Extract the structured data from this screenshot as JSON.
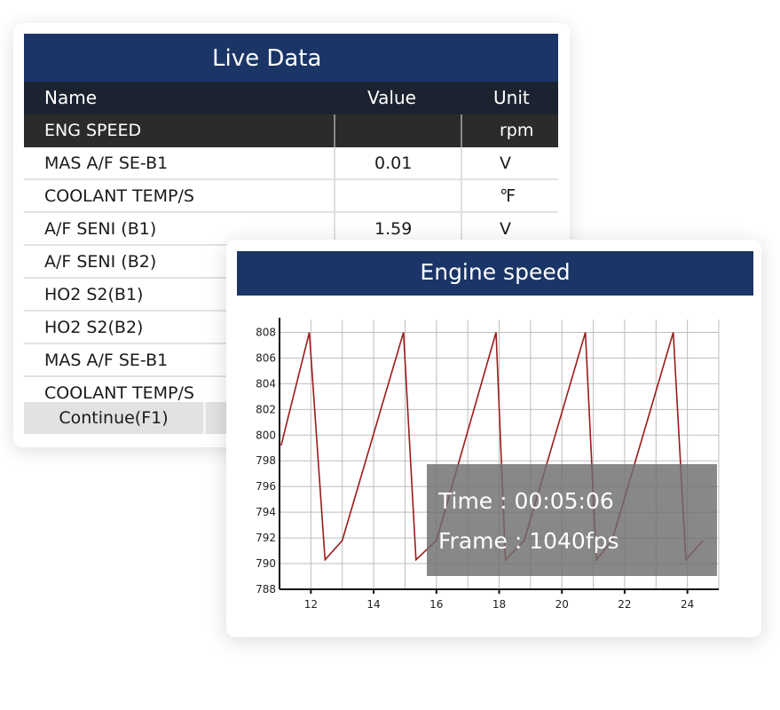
{
  "live_data": {
    "title": "Live Data",
    "columns": {
      "name": "Name",
      "value": "Value",
      "unit": "Unit"
    },
    "rows": [
      {
        "name": "ENG SPEED",
        "value": "",
        "unit": "rpm"
      },
      {
        "name": "MAS A/F SE-B1",
        "value": "0.01",
        "unit": "V"
      },
      {
        "name": "COOLANT TEMP/S",
        "value": "",
        "unit": "℉"
      },
      {
        "name": "A/F SENI (B1)",
        "value": "1.59",
        "unit": "V"
      },
      {
        "name": "A/F SENI (B2)",
        "value": "",
        "unit": ""
      },
      {
        "name": "HO2 S2(B1)",
        "value": "",
        "unit": ""
      },
      {
        "name": "HO2 S2(B2)",
        "value": "",
        "unit": ""
      },
      {
        "name": "MAS A/F SE-B1",
        "value": "",
        "unit": ""
      },
      {
        "name": "COOLANT TEMP/S",
        "value": "",
        "unit": ""
      }
    ],
    "continue_label": "Continue(F1)"
  },
  "engine_speed": {
    "title": "Engine speed",
    "time_text": "Time : 00:05:06",
    "frame_text": "Frame : 1040fps"
  },
  "chart_data": {
    "type": "line",
    "title": "",
    "xlabel": "",
    "ylabel": "",
    "xlim": [
      11,
      25
    ],
    "ylim": [
      788,
      809
    ],
    "x_ticks": [
      12,
      14,
      16,
      18,
      20,
      22,
      24
    ],
    "y_ticks": [
      788,
      790,
      792,
      794,
      796,
      798,
      800,
      802,
      804,
      806,
      808
    ],
    "grid": true,
    "series_color": "#9b1b1b",
    "series": [
      {
        "x": [
          11.05,
          11.95,
          12.45,
          13.0,
          14.95,
          15.35,
          16.0,
          17.9,
          18.2,
          18.8,
          20.75,
          21.1,
          21.6,
          23.55,
          23.95,
          24.5
        ],
        "y": [
          799.2,
          808.0,
          790.3,
          791.8,
          808.0,
          790.3,
          791.8,
          808.0,
          790.3,
          791.8,
          808.0,
          790.3,
          791.8,
          808.0,
          790.3,
          791.8
        ]
      }
    ]
  }
}
